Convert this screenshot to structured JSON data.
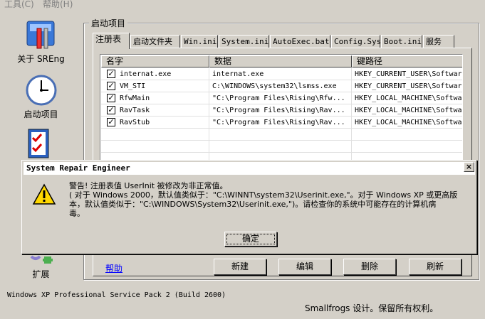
{
  "menu": {
    "tools": "工具(C)",
    "help": "帮助(H)"
  },
  "sidebar": {
    "items": [
      {
        "label": "关于 SREng"
      },
      {
        "label": "启动项目"
      },
      {
        "label": ""
      },
      {
        "label": "扩展"
      }
    ]
  },
  "group": {
    "title": "启动项目"
  },
  "tabs": [
    "注册表",
    "启动文件夹",
    "Win.ini",
    "System.ini",
    "AutoExec.bat",
    "Config.Sys",
    "Boot.ini",
    "服务"
  ],
  "list": {
    "columns": [
      "名字",
      "数据",
      "键路径"
    ],
    "rows": [
      {
        "checked": true,
        "name": "internat.exe",
        "data": "internat.exe",
        "path": "HKEY_CURRENT_USER\\Softwar"
      },
      {
        "checked": true,
        "name": "VM_STI",
        "data": "C:\\WINDOWS\\system32\\lsmss.exe",
        "path": "HKEY_CURRENT_USER\\Softwar"
      },
      {
        "checked": true,
        "name": "RfwMain",
        "data": "\"C:\\Program Files\\Rising\\Rfw...",
        "path": "HKEY_LOCAL_MACHINE\\Softwa"
      },
      {
        "checked": true,
        "name": "RavTask",
        "data": "\"C:\\Program Files\\Rising\\Rav...",
        "path": "HKEY_LOCAL_MACHINE\\Softwa"
      },
      {
        "checked": true,
        "name": "RavStub",
        "data": "\"C:\\Program Files\\Rising\\Rav...",
        "path": "HKEY_LOCAL_MACHINE\\Softwa"
      }
    ]
  },
  "buttons": {
    "help": "帮助",
    "new": "新建",
    "edit": "编辑",
    "delete": "删除",
    "refresh": "刷新"
  },
  "status": {
    "os": "Windows XP Professional Service Pack 2 (Build 2600)",
    "credit": "Smallfrogs 设计。保留所有权利。"
  },
  "dialog": {
    "title": "System Repair Engineer",
    "close": "×",
    "lines": [
      "警告! 注册表值 UserInit 被修改为非正常值。",
      "( 对于 Windows 2000，默认值类似于：\"C:\\WINNT\\system32\\Userinit.exe,\"。对于 Windows XP 或更高版",
      "本，默认值类似于：\"C:\\WINDOWS\\System32\\Userinit.exe,\")。请检查你的系统中可能存在的计算机病",
      "毒。"
    ],
    "ok": "确定"
  }
}
